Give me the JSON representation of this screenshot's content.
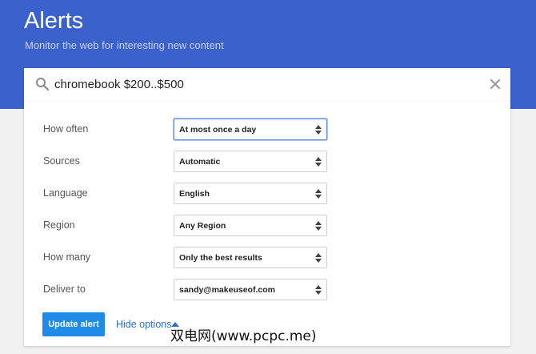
{
  "header": {
    "title": "Alerts",
    "subtitle": "Monitor the web for interesting new content",
    "background_color": "#3a61cc"
  },
  "search": {
    "icon": "search-icon",
    "value": "chromebook $200..$500",
    "clear_icon": "close-icon"
  },
  "options": [
    {
      "label": "How often",
      "value": "At most once a day",
      "focused": true
    },
    {
      "label": "Sources",
      "value": "Automatic"
    },
    {
      "label": "Language",
      "value": "English"
    },
    {
      "label": "Region",
      "value": "Any Region"
    },
    {
      "label": "How many",
      "value": "Only the best results"
    },
    {
      "label": "Deliver to",
      "value": "sandy@makeuseof.com"
    }
  ],
  "actions": {
    "update_label": "Update alert",
    "hide_options_label": "Hide options",
    "accent_color": "#1e8ce6"
  },
  "watermark": {
    "text": "双电网(www.pcpc.me)"
  }
}
